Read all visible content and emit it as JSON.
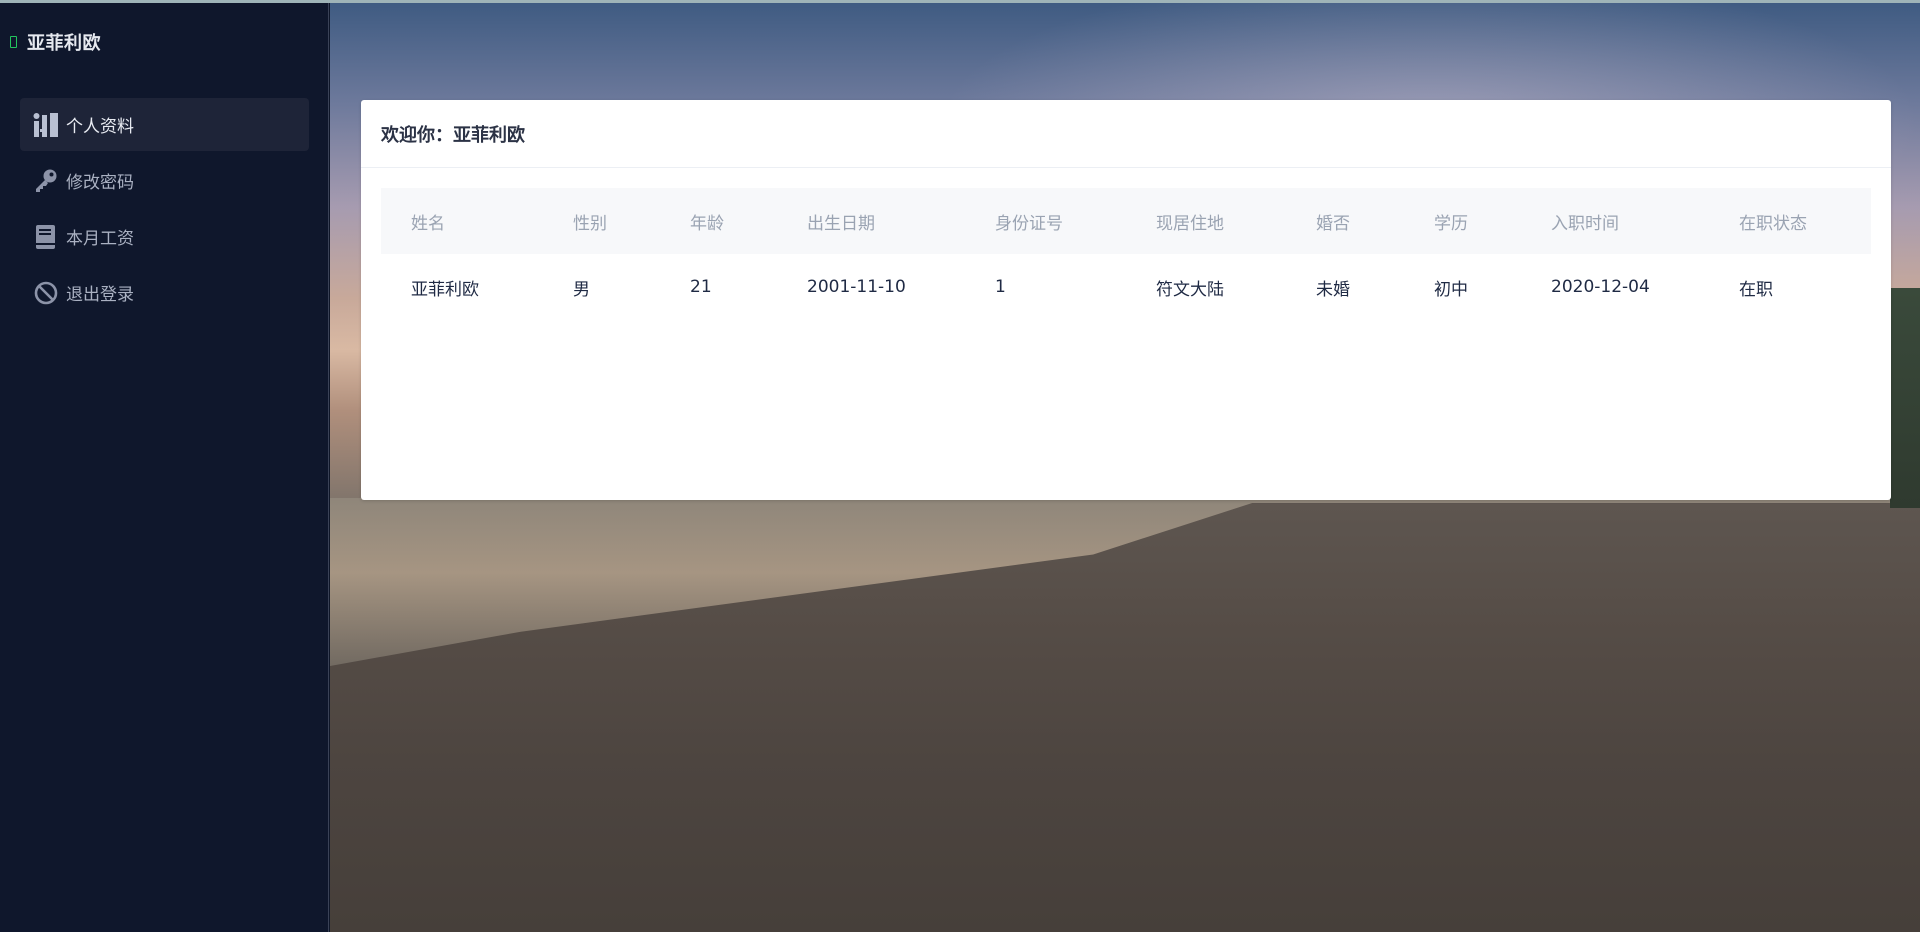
{
  "sidebar": {
    "brand": "亚菲利欧",
    "items": [
      {
        "label": "个人资料",
        "icon": "profile-icon",
        "active": true
      },
      {
        "label": "修改密码",
        "icon": "key-icon",
        "active": false
      },
      {
        "label": "本月工资",
        "icon": "book-icon",
        "active": false
      },
      {
        "label": "退出登录",
        "icon": "ban-icon",
        "active": false
      }
    ]
  },
  "card": {
    "welcome": "欢迎你：亚菲利欧",
    "table": {
      "columns": [
        "姓名",
        "性别",
        "年龄",
        "出生日期",
        "身份证号",
        "现居住地",
        "婚否",
        "学历",
        "入职时间",
        "在职状态"
      ],
      "rows": [
        [
          "亚菲利欧",
          "男",
          "21",
          "2001-11-10",
          "1",
          "符文大陆",
          "未婚",
          "初中",
          "2020-12-04",
          "在职"
        ]
      ]
    }
  },
  "colors": {
    "sidebar_bg": "#0f172c",
    "active_item_bg": "#1e2438",
    "brand_mark": "#22c55e",
    "card_bg": "#ffffff",
    "table_header_bg": "#f7f8fa"
  }
}
